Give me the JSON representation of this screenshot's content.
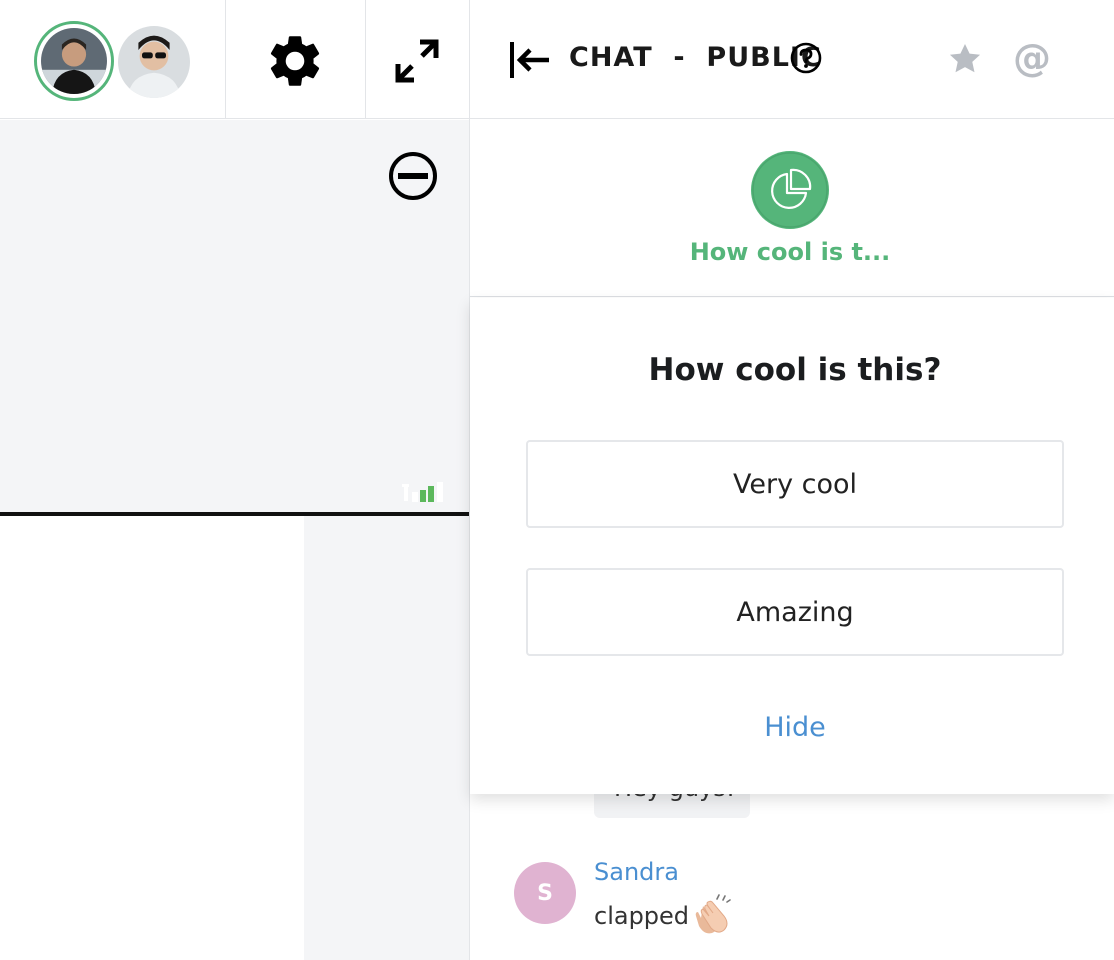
{
  "header": {
    "participants": [
      {
        "icon": "user-avatar-1",
        "active": true
      },
      {
        "icon": "user-avatar-2",
        "active": false
      }
    ],
    "settings_icon": "gear-icon",
    "fullscreen_icon": "expand-icon"
  },
  "stage": {
    "minimize_icon": "minus-circle-icon",
    "signal_icon": "signal-bars-icon"
  },
  "chat": {
    "collapse_icon": "collapse-left-icon",
    "title": "CHAT  -  PUBLIC",
    "help_icon": "question-circle-icon",
    "favorites_icon": "star-icon",
    "mentions_label": "@",
    "poll_chip_label": "How cool is t...",
    "messages": [
      {
        "text": "Hey guys!"
      },
      {
        "sender": "Sandra",
        "initial": "S",
        "text": "clapped",
        "reaction_icon": "clapping-hands-icon"
      }
    ]
  },
  "poll": {
    "question": "How cool is this?",
    "options": [
      "Very cool",
      "Amazing"
    ],
    "hide_label": "Hide"
  },
  "colors": {
    "accent_green": "#55b57a",
    "link_blue": "#4a8fd1",
    "avatar_pink": "#e0b3d1",
    "muted_grey": "#b9bdc3"
  }
}
